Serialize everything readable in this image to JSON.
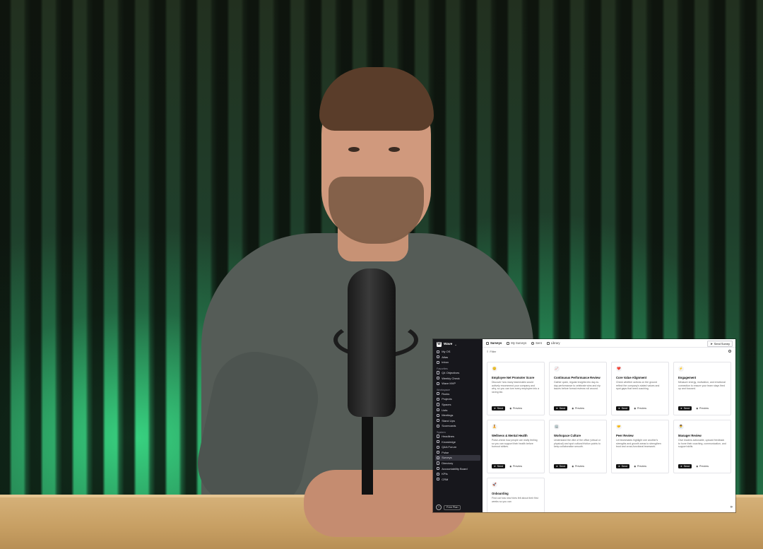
{
  "sidebar": {
    "workspace": "Wave",
    "top_items": [
      {
        "label": "My OS",
        "icon": "home-icon"
      },
      {
        "label": "Atlas",
        "icon": "compass-icon"
      },
      {
        "label": "Inbox",
        "icon": "inbox-icon"
      }
    ],
    "favorites_label": "Favorites",
    "favorites": [
      {
        "label": "Q4 Objectives",
        "icon": "target-icon"
      },
      {
        "label": "Weekly Check",
        "icon": "calendar-icon"
      },
      {
        "label": "Wave MVP",
        "icon": "rocket-icon"
      }
    ],
    "workspace_label": "Workspace",
    "workspace_items": [
      {
        "label": "Rocks",
        "icon": "rock-icon"
      },
      {
        "label": "Projects",
        "icon": "folder-icon"
      },
      {
        "label": "Spaces",
        "icon": "grid-icon"
      },
      {
        "label": "Lists",
        "icon": "list-icon"
      },
      {
        "label": "Meetings",
        "icon": "video-icon"
      },
      {
        "label": "Stand Ups",
        "icon": "users-icon"
      },
      {
        "label": "Scorecards",
        "icon": "chart-icon"
      }
    ],
    "system_label": "System",
    "system_items": [
      {
        "label": "Headlines",
        "icon": "newspaper-icon"
      },
      {
        "label": "Knowledge",
        "icon": "book-icon"
      },
      {
        "label": "Q&A Forum",
        "icon": "chat-icon"
      },
      {
        "label": "Pulse",
        "icon": "pulse-icon"
      },
      {
        "label": "Surveys",
        "icon": "survey-icon",
        "active": true
      },
      {
        "label": "Directory",
        "icon": "contacts-icon"
      },
      {
        "label": "Accountability Board",
        "icon": "board-icon"
      },
      {
        "label": "KPIs",
        "icon": "gauge-icon"
      },
      {
        "label": "CRM",
        "icon": "crm-icon"
      }
    ],
    "plan_label": "Free Plan"
  },
  "topbar": {
    "tabs": [
      {
        "label": "Surveys",
        "active": true
      },
      {
        "label": "My Surveys"
      },
      {
        "label": "Sent"
      },
      {
        "label": "Library"
      }
    ],
    "send_survey_label": "Send Survey"
  },
  "filter_label": "Filter",
  "buttons": {
    "send": "Send",
    "preview": "Preview"
  },
  "cards": [
    {
      "emoji": "😊",
      "title": "Employee Net Promoter Score",
      "desc": "Discover how many teammates would actively recommend your company and why, so you can turn every employee into a raving fan."
    },
    {
      "emoji": "📈",
      "title": "Continuous Performance Review",
      "desc": "Gather quick, regular insights into day-to-day performance to celebrate wins and nip issues before formal reviews roll around."
    },
    {
      "emoji": "❤️",
      "title": "Core Value Alignment",
      "desc": "Check whether actions on the ground reflect the company's stated values and spot gaps that need coaching."
    },
    {
      "emoji": "⚡",
      "title": "Engagement",
      "desc": "Measure energy, motivation, and emotional connection to ensure your team stays fired up and focused."
    },
    {
      "emoji": "🧘",
      "title": "Wellness & Mental Health",
      "desc": "Pulse-check how people are really feeling so you can support their health before burnout strikes."
    },
    {
      "emoji": "🏢",
      "title": "Workspace Culture",
      "desc": "Understand the vibe of the office (virtual or physical) and spot cultural friction points to keep collaboration smooth."
    },
    {
      "emoji": "🤝",
      "title": "Peer Review",
      "desc": "Let teammates highlight one another's strengths and growth areas to strengthen trust and cross-functional teamwork."
    },
    {
      "emoji": "👨‍💼",
      "title": "Manager Review",
      "desc": "Give leaders actionable, upward feedback to hone their coaching, communication, and support skills."
    },
    {
      "emoji": "🚀",
      "title": "Onboarding",
      "desc": "Find out how new hires felt about their first weeks so you can"
    }
  ],
  "colors": {
    "sidebar_bg": "#17171c",
    "accent": "#111111",
    "wall_glow": "#3ce68c"
  }
}
